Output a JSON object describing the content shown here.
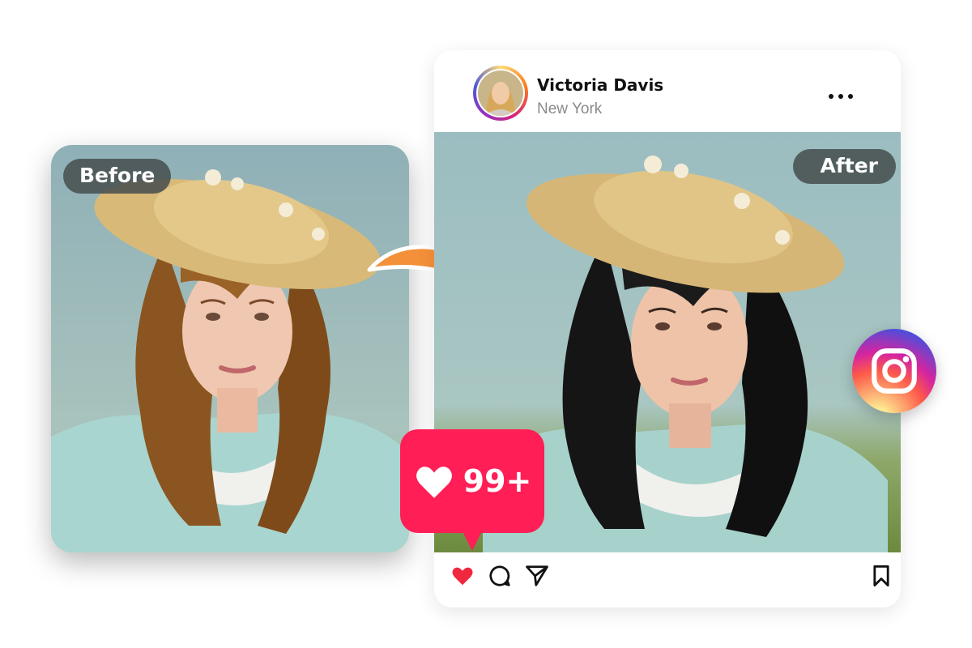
{
  "before": {
    "label": "Before"
  },
  "post": {
    "username": "Victoria Davis",
    "location": "New York",
    "after_label": "After",
    "like_count": "99+"
  },
  "icons": [
    "arrow-right-curved-icon",
    "more-dots-icon",
    "heart-icon",
    "comment-icon",
    "share-icon",
    "bookmark-icon",
    "instagram-icon"
  ],
  "colors": {
    "like_red": "#ff1e56",
    "arrow_orange": "#f5903a",
    "pill_bg": "#464e4e",
    "hair_before": "#8a5520",
    "hair_after": "#151515"
  }
}
